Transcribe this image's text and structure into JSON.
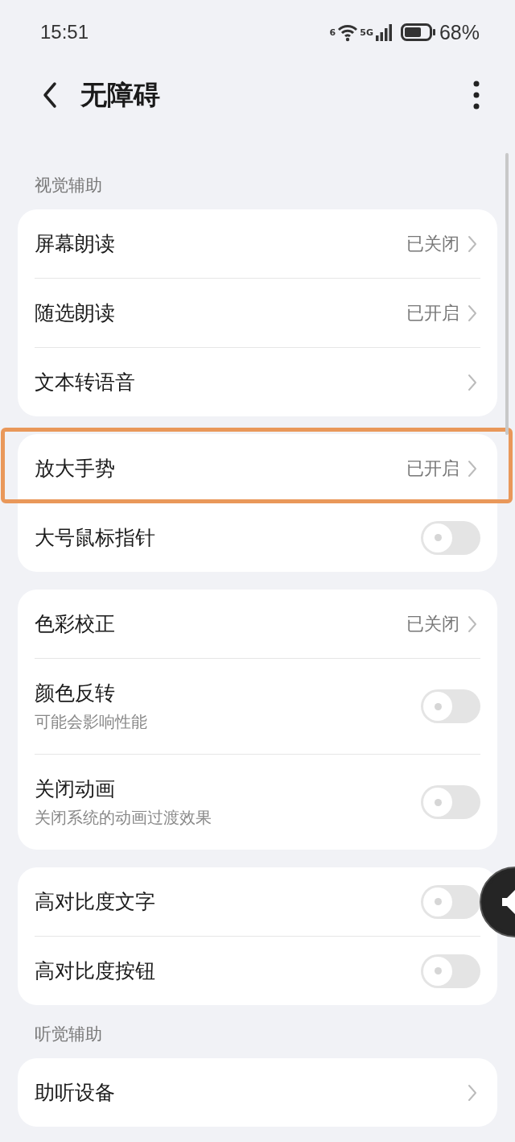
{
  "status_bar": {
    "time": "15:51",
    "wifi_label": "6",
    "network_label": "5G",
    "battery_percent": "68%"
  },
  "header": {
    "title": "无障碍"
  },
  "sections": [
    {
      "label": "视觉辅助",
      "cards": [
        [
          {
            "kind": "link",
            "title": "屏幕朗读",
            "value": "已关闭",
            "highlighted": false
          },
          {
            "kind": "link",
            "title": "随选朗读",
            "value": "已开启",
            "highlighted": false
          },
          {
            "kind": "link",
            "title": "文本转语音",
            "highlighted": false
          }
        ],
        [
          {
            "kind": "link",
            "title": "放大手势",
            "value": "已开启",
            "highlighted": true
          },
          {
            "kind": "toggle",
            "title": "大号鼠标指针",
            "on": false,
            "highlighted": false
          }
        ],
        [
          {
            "kind": "link",
            "title": "色彩校正",
            "value": "已关闭",
            "highlighted": false
          },
          {
            "kind": "toggle",
            "title": "颜色反转",
            "subtitle": "可能会影响性能",
            "on": false,
            "highlighted": false
          },
          {
            "kind": "toggle",
            "title": "关闭动画",
            "subtitle": "关闭系统的动画过渡效果",
            "on": false,
            "highlighted": false
          }
        ],
        [
          {
            "kind": "toggle",
            "title": "高对比度文字",
            "on": false,
            "highlighted": false
          },
          {
            "kind": "toggle",
            "title": "高对比度按钮",
            "on": false,
            "highlighted": false
          }
        ]
      ]
    },
    {
      "label": "听觉辅助",
      "cards": [
        [
          {
            "kind": "link",
            "title": "助听设备",
            "highlighted": false
          }
        ]
      ]
    }
  ]
}
